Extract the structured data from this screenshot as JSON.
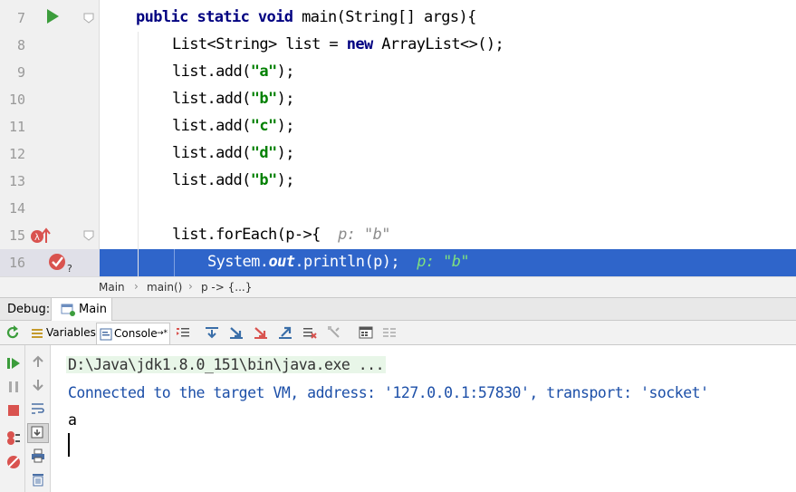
{
  "editor": {
    "lines": [
      {
        "num": "7"
      },
      {
        "num": "8"
      },
      {
        "num": "9"
      },
      {
        "num": "10"
      },
      {
        "num": "11"
      },
      {
        "num": "12"
      },
      {
        "num": "13"
      },
      {
        "num": "14"
      },
      {
        "num": "15"
      },
      {
        "num": "16"
      }
    ],
    "code": {
      "l7_kw": "public static void",
      "l7_rest": " main(String[] args){",
      "l8_a": "List<String> list = ",
      "l8_kw": "new",
      "l8_b": " ArrayList<>();",
      "l9_a": "list.add(",
      "l9_s": "\"a\"",
      "l9_b": ");",
      "l10_a": "list.add(",
      "l10_s": "\"b\"",
      "l10_b": ");",
      "l11_a": "list.add(",
      "l11_s": "\"c\"",
      "l11_b": ");",
      "l12_a": "list.add(",
      "l12_s": "\"d\"",
      "l12_b": ");",
      "l13_a": "list.add(",
      "l13_s": "\"b\"",
      "l13_b": ");",
      "l15_a": "list.forEach(p->{",
      "l15_hint": "  p: \"b\"",
      "l16_a": "System.",
      "l16_field": "out",
      "l16_b": ".println(p);",
      "l16_hint": "  p: \"b\""
    }
  },
  "breadcrumb": {
    "items": [
      "Main",
      "main()",
      "p -> {...}"
    ],
    "separator": "›"
  },
  "debug": {
    "label": "Debug:",
    "session_tab": "Main",
    "tabs": {
      "variables": "Variables",
      "console": "Console",
      "console_suffix": "→*"
    }
  },
  "console": {
    "command": "D:\\Java\\jdk1.8.0_151\\bin\\java.exe ...",
    "connected": "Connected to the target VM, address: '127.0.0.1:57830', transport: 'socket'",
    "output": "a"
  },
  "colors": {
    "current_line": "#2f65ca",
    "keyword": "#000080",
    "string": "#008000",
    "console_info": "#1c4fa8"
  }
}
